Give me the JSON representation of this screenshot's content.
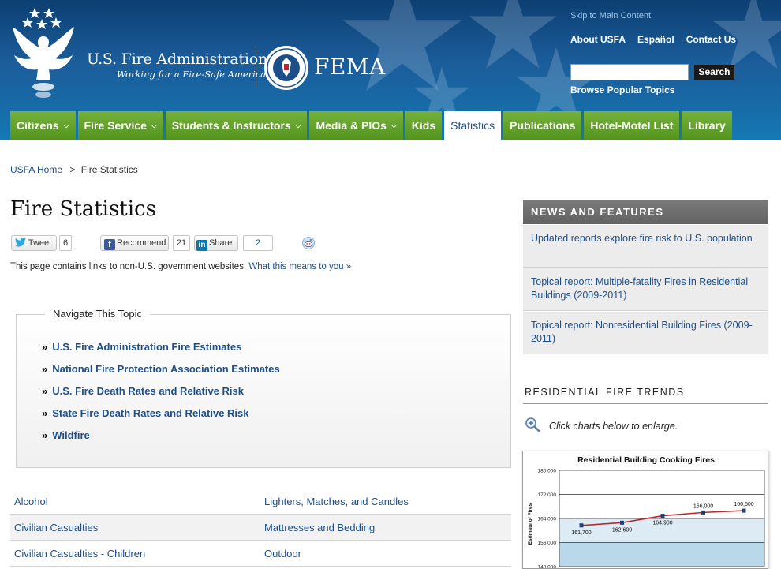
{
  "header": {
    "org_title": "U.S. Fire Administration",
    "tagline": "Working for a Fire-Safe America",
    "fema_label": "FEMA",
    "skip_link": "Skip to Main Content",
    "top_links": [
      "About USFA",
      "Español",
      "Contact Us"
    ],
    "search": {
      "value": "",
      "placeholder": "",
      "button_label": "Search"
    },
    "browse_link": "Browse Popular Topics"
  },
  "nav": {
    "tabs": [
      {
        "label": "Citizens",
        "dropdown": true
      },
      {
        "label": "Fire Service",
        "dropdown": true
      },
      {
        "label": "Students & Instructors",
        "dropdown": true
      },
      {
        "label": "Media & PIOs",
        "dropdown": true
      },
      {
        "label": "Kids",
        "dropdown": false
      },
      {
        "label": "Statistics",
        "dropdown": false,
        "active": true
      },
      {
        "label": "Publications",
        "dropdown": false
      },
      {
        "label": "Hotel-Motel List",
        "dropdown": false
      },
      {
        "label": "Library",
        "dropdown": false
      }
    ],
    "caret_glyph": "⌵"
  },
  "breadcrumb": {
    "home": "USFA Home",
    "separator": ">",
    "current": "Fire Statistics"
  },
  "page_title": "Fire Statistics",
  "social": {
    "tweet_label": "Tweet",
    "tweet_count": "6",
    "recommend_label": "Recommend",
    "recommend_count": "21",
    "share_label": "Share",
    "share_count": "2"
  },
  "disclaimer": {
    "text": "This page contains links to non-U.S. government websites.",
    "link": "What this means to you »"
  },
  "navigate_topic": {
    "legend": "Navigate This Topic",
    "bullet": "»",
    "links": [
      "U.S. Fire Administration Fire Estimates",
      "National Fire Protection Association Estimates",
      "U.S. Fire Death Rates and Relative Risk",
      "State Fire Death Rates and Relative Risk",
      "Wildfire"
    ]
  },
  "topics": [
    [
      "Alcohol",
      "Lighters, Matches, and Candles"
    ],
    [
      "Civilian Casualties",
      "Mattresses and Bedding"
    ],
    [
      "Civilian Casualties - Children",
      "Outdoor"
    ]
  ],
  "sidebar": {
    "news_heading": "NEWS AND FEATURES",
    "news_items": [
      "Updated reports explore fire risk to U.S. population",
      "Topical report: Multiple-fatality Fires in Residential Buildings (2009-2011)",
      "Topical report: Nonresidential Building Fires (2009-2011)"
    ],
    "trends_heading": "RESIDENTIAL FIRE TRENDS",
    "click_note": "Click charts below to enlarge."
  },
  "colors": {
    "nav_green": "#5fa02a",
    "link_blue": "#1d4f8c",
    "header_blue": "#1b5d9a",
    "series_line": "#b8292f",
    "series_marker": "#1f3f7a"
  },
  "chart_data": {
    "type": "line",
    "title": "Residential Building Cooking Fires",
    "ylabel": "Estimate of Fires",
    "ylim": [
      148000,
      180000
    ],
    "yticks": [
      "180,000",
      "172,000",
      "164,000",
      "156,000",
      "148,000"
    ],
    "ytick_values": [
      180000,
      172000,
      164000,
      156000,
      148000
    ],
    "series": [
      {
        "values": [
          161700,
          162600,
          164900,
          166000,
          166600
        ],
        "labels": [
          "161,700",
          "162,600",
          "164,900",
          "166,000",
          "166,600"
        ]
      }
    ]
  }
}
